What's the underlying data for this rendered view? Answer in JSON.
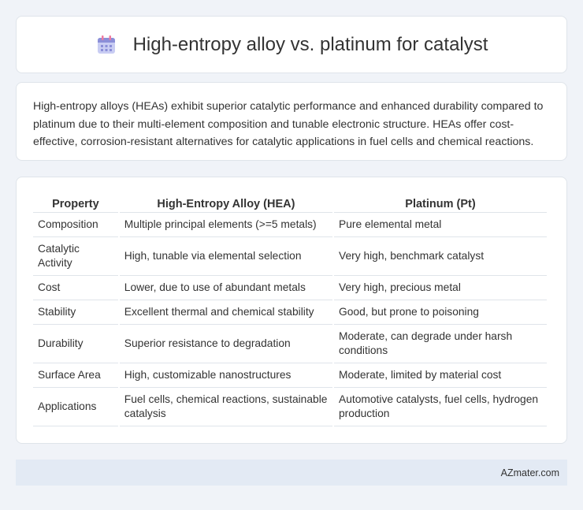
{
  "header": {
    "title": "High-entropy alloy vs. platinum for catalyst",
    "icon": "calendar-icon",
    "icon_color": "#8b8fd8"
  },
  "intro": {
    "text": "High-entropy alloys (HEAs) exhibit superior catalytic performance and enhanced durability compared to platinum due to their multi-element composition and tunable electronic structure. HEAs offer cost-effective, corrosion-resistant alternatives for catalytic applications in fuel cells and chemical reactions."
  },
  "table": {
    "headers": [
      "Property",
      "High-Entropy Alloy (HEA)",
      "Platinum (Pt)"
    ],
    "rows": [
      [
        "Composition",
        "Multiple principal elements (>=5 metals)",
        "Pure elemental metal"
      ],
      [
        "Catalytic Activity",
        "High, tunable via elemental selection",
        "Very high, benchmark catalyst"
      ],
      [
        "Cost",
        "Lower, due to use of abundant metals",
        "Very high, precious metal"
      ],
      [
        "Stability",
        "Excellent thermal and chemical stability",
        "Good, but prone to poisoning"
      ],
      [
        "Durability",
        "Superior resistance to degradation",
        "Moderate, can degrade under harsh conditions"
      ],
      [
        "Surface Area",
        "High, customizable nanostructures",
        "Moderate, limited by material cost"
      ],
      [
        "Applications",
        "Fuel cells, chemical reactions, sustainable catalysis",
        "Automotive catalysts, fuel cells, hydrogen production"
      ]
    ]
  },
  "footer": {
    "brand": "AZmater.com"
  }
}
